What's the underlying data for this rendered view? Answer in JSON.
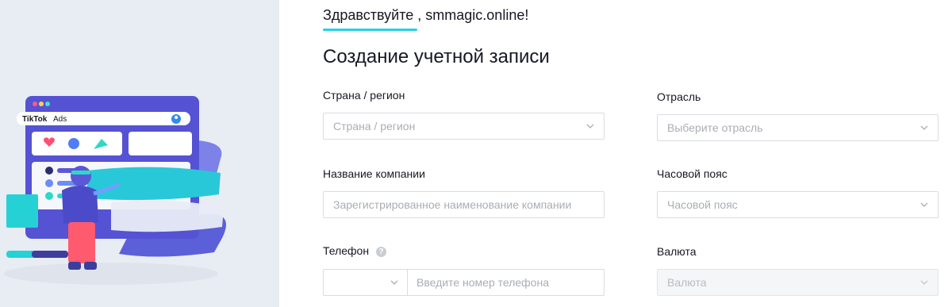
{
  "illustration": {
    "brand": "TikTok",
    "product": "Ads"
  },
  "greeting": {
    "word": "Здравствуйте",
    "rest": " , smmagic.online!"
  },
  "page_title": "Создание учетной записи",
  "form": {
    "country": {
      "label": "Страна / регион",
      "placeholder": "Страна / регион"
    },
    "industry": {
      "label": "Отрасль",
      "placeholder": "Выберите отрасль"
    },
    "company": {
      "label": "Название компании",
      "placeholder": "Зарегистрированное наименование компании"
    },
    "timezone": {
      "label": "Часовой пояс",
      "placeholder": "Часовой пояс"
    },
    "phone": {
      "label": "Телефон",
      "help": "?",
      "placeholder": "Введите номер телефона"
    },
    "currency": {
      "label": "Валюта",
      "placeholder": "Валюта"
    }
  },
  "colors": {
    "accent": "#25d1e0",
    "panel_bg": "#e8ecf3",
    "window_purple": "#5b57d6"
  }
}
